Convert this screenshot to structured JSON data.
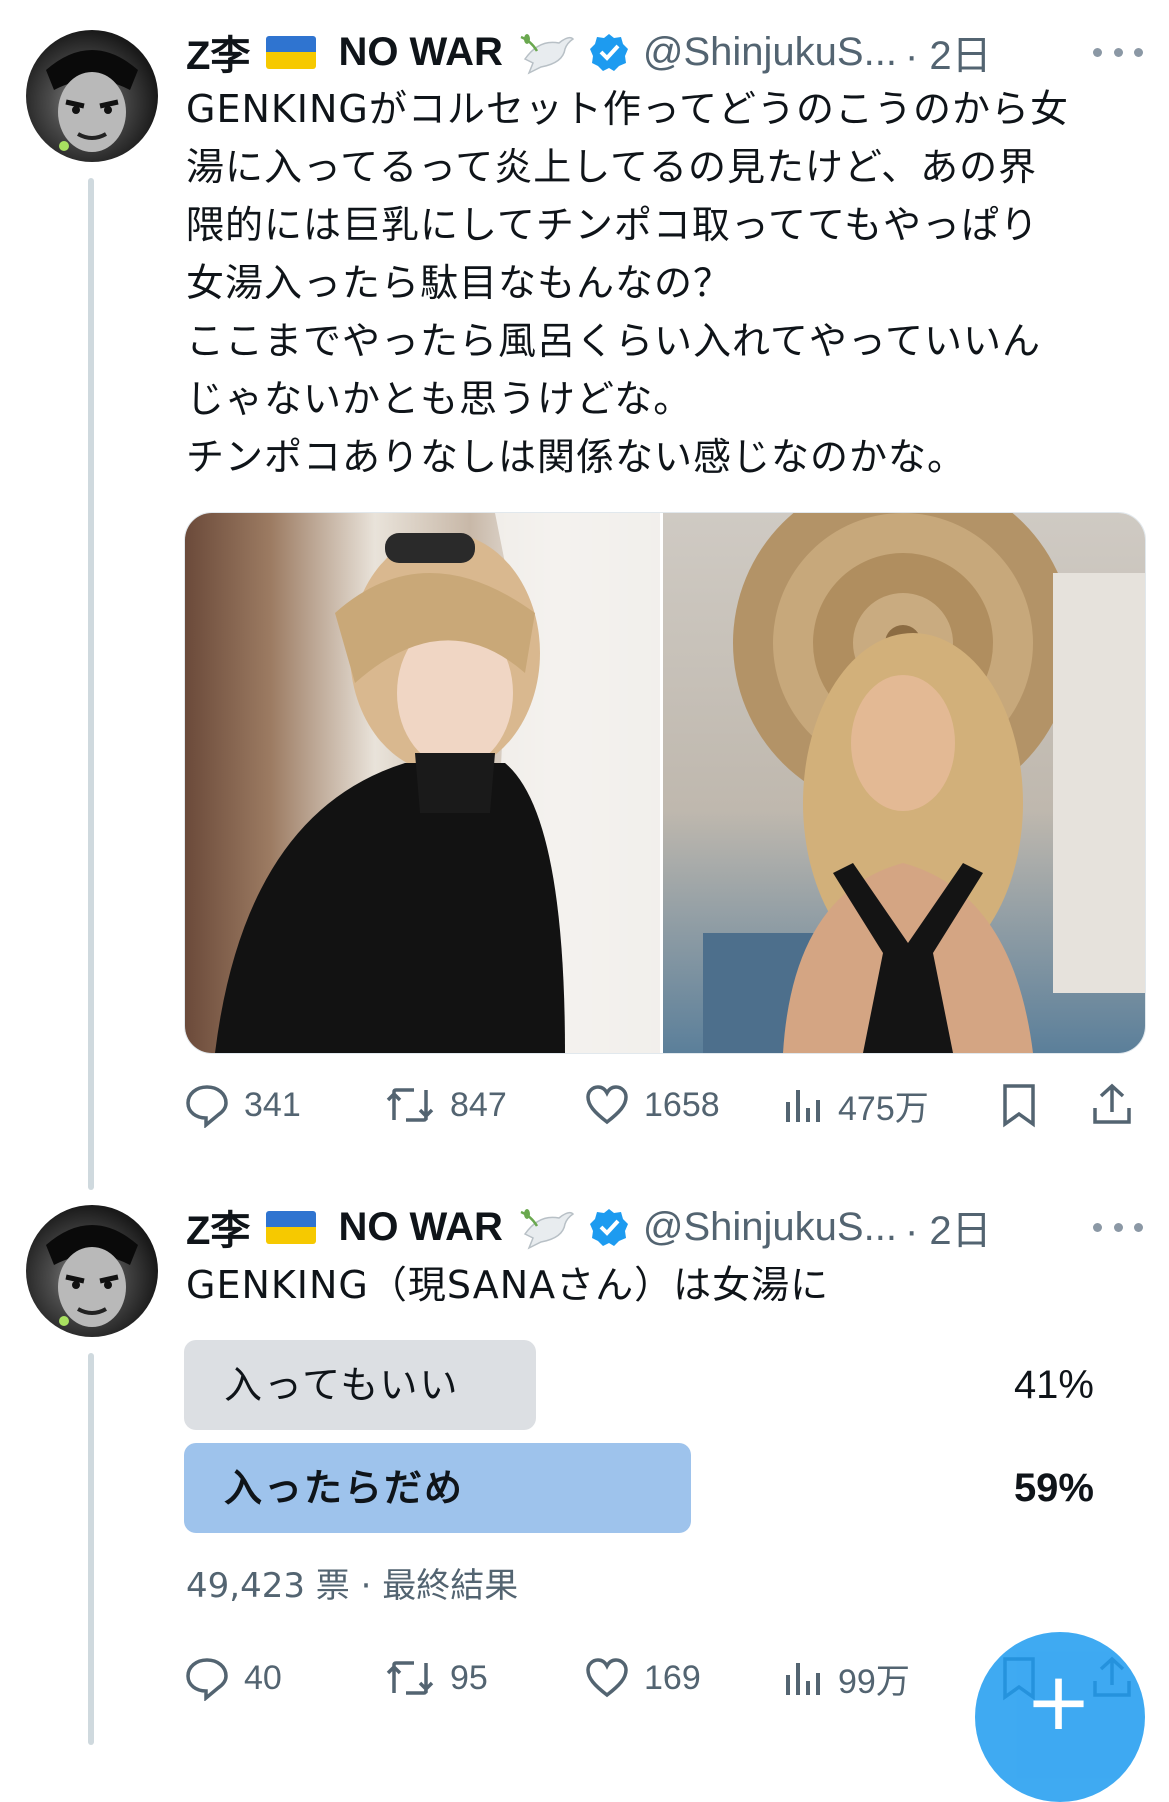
{
  "tweets": [
    {
      "author": {
        "name": "Z李",
        "flag_label": "NO WAR",
        "handle": "@ShinjukuS...",
        "time": "· 2日"
      },
      "text_lines": [
        "GENKINGがコルセット作ってどうのこうのから女",
        "湯に入ってるって炎上してるの見たけど、あの界",
        "隈的には巨乳にしてチンポコ取っててもやっぱり",
        "女湯入ったら駄目なもんなの？",
        "ここまでやったら風呂くらい入れてやっていいん",
        "じゃないかとも思うけどな。",
        "チンポコありなしは関係ない感じなのかな。"
      ],
      "metrics": {
        "replies": "341",
        "retweets": "847",
        "likes": "1658",
        "views": "475万"
      }
    },
    {
      "author": {
        "name": "Z李",
        "flag_label": "NO WAR",
        "handle": "@ShinjukuS...",
        "time": "· 2日"
      },
      "text": "GENKING（現SANAさん）は女湯に",
      "poll": {
        "options": [
          {
            "label": "入ってもいい",
            "percent_text": "41%",
            "percent": 41,
            "winner": false
          },
          {
            "label": "入ったらだめ",
            "percent_text": "59%",
            "percent": 59,
            "winner": true
          }
        ],
        "meta": "49,423 票 · 最終結果"
      },
      "metrics": {
        "replies": "40",
        "retweets": "95",
        "likes": "169",
        "views": "99万"
      }
    }
  ],
  "colors": {
    "accent": "#1d9bf0",
    "verified": "#1d9bf0",
    "muted": "#536471",
    "poll_winner": "#9ec3ec",
    "poll_other": "#dcdfe3"
  },
  "icons": [
    "reply-icon",
    "retweet-icon",
    "like-icon",
    "views-icon",
    "bookmark-icon",
    "share-icon",
    "more-icon",
    "verified-icon",
    "dove-icon",
    "ukraine-flag-icon"
  ]
}
